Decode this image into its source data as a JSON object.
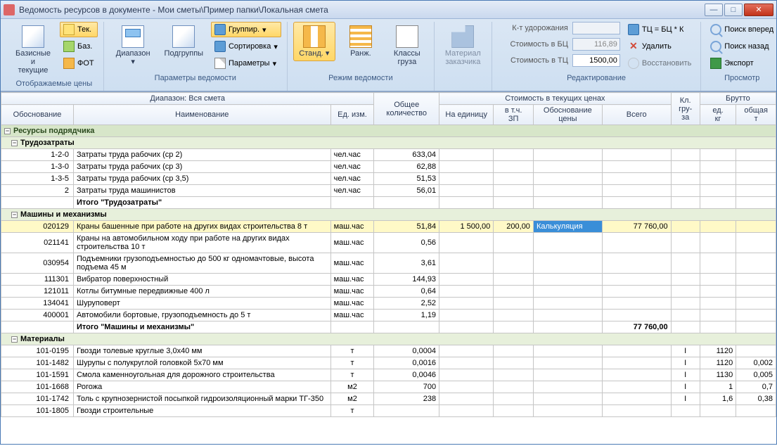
{
  "window": {
    "title": "Ведомость ресурсов в документе - Мои сметы\\Пример папки\\Локальная смета"
  },
  "ribbon": {
    "grp_prices": {
      "big": "Базисные\nи текущие",
      "tek": "Тек.",
      "baz": "Баз.",
      "fot": "ФОТ",
      "label": "Отображаемые цены"
    },
    "grp_params": {
      "range": "Диапазон",
      "subgroups": "Подгруппы",
      "group": "Группир.",
      "sort": "Сортировка",
      "params": "Параметры",
      "label": "Параметры ведомости"
    },
    "grp_mode": {
      "std": "Станд.",
      "rank": "Ранж.",
      "classes": "Классы\nгруза",
      "label": "Режим ведомости"
    },
    "grp_cust": {
      "mat": "Материал\nзаказчика"
    },
    "grp_edit": {
      "kud": "К-т удорожания",
      "sbc": "Стоимость в БЦ",
      "stc": "Стоимость в ТЦ",
      "sbc_val": "116,89",
      "stc_val": "1500,00",
      "formula": "ТЦ = БЦ * К",
      "del": "Удалить",
      "restore": "Восстановить",
      "label": "Редактирование"
    },
    "grp_view": {
      "fwd": "Поиск вперед",
      "back": "Поиск назад",
      "export": "Экспорт",
      "label": "Просмотр"
    }
  },
  "headers": {
    "range_full": "Диапазон: Вся смета",
    "obos": "Обоснование",
    "name": "Наименование",
    "ed": "Ед. изм.",
    "qty": "Общее\nколичество",
    "cost_group": "Стоимость в текущих ценах",
    "unit": "На единицу",
    "zp": "в т.ч.\nЗП",
    "obosn_price": "Обоснование\nцены",
    "total": "Всего",
    "kl": "Кл.\nгру-\nза",
    "brutto": "Брутто",
    "edkg": "ед.\nкг",
    "obsh": "общая\nт"
  },
  "groups": {
    "g1": "Ресурсы подрядчика",
    "g2": "Трудозатраты",
    "g2_total": "Итого \"Трудозатраты\"",
    "g3": "Машины и механизмы",
    "g3_total": "Итого \"Машины и механизмы\"",
    "g3_total_val": "77 760,00",
    "g4": "Материалы"
  },
  "rows": {
    "r1": {
      "code": "1-2-0",
      "name": "Затраты труда рабочих (ср 2)",
      "ed": "чел.час",
      "qty": "633,04"
    },
    "r2": {
      "code": "1-3-0",
      "name": "Затраты труда рабочих (ср 3)",
      "ed": "чел.час",
      "qty": "62,88"
    },
    "r3": {
      "code": "1-3-5",
      "name": "Затраты труда рабочих (ср 3,5)",
      "ed": "чел.час",
      "qty": "51,53"
    },
    "r4": {
      "code": "2",
      "name": "Затраты труда машинистов",
      "ed": "чел.час",
      "qty": "56,01"
    },
    "m1": {
      "code": "020129",
      "name": "Краны башенные при работе на других видах строительства 8 т",
      "ed": "маш.час",
      "qty": "51,84",
      "unit": "1 500,00",
      "zp": "200,00",
      "obp": "Калькуляция",
      "total": "77 760,00"
    },
    "m2": {
      "code": "021141",
      "name": "Краны на автомобильном ходу при работе на других видах строительства 10 т",
      "ed": "маш.час",
      "qty": "0,56"
    },
    "m3": {
      "code": "030954",
      "name": "Подъемники грузоподъемностью до 500 кг одномачтовые, высота подъема 45 м",
      "ed": "маш.час",
      "qty": "3,61"
    },
    "m4": {
      "code": "111301",
      "name": "Вибратор поверхностный",
      "ed": "маш.час",
      "qty": "144,93"
    },
    "m5": {
      "code": "121011",
      "name": "Котлы битумные передвижные 400 л",
      "ed": "маш.час",
      "qty": "0,64"
    },
    "m6": {
      "code": "134041",
      "name": "Шуруповерт",
      "ed": "маш.час",
      "qty": "2,52"
    },
    "m7": {
      "code": "400001",
      "name": "Автомобили бортовые, грузоподъемность до 5 т",
      "ed": "маш.час",
      "qty": "1,19"
    },
    "mat1": {
      "code": "101-0195",
      "name": "Гвозди толевые круглые 3,0х40 мм",
      "ed": "т",
      "qty": "0,0004",
      "kl": "I",
      "kg": "1120"
    },
    "mat2": {
      "code": "101-1482",
      "name": "Шурупы с полукруглой головкой 5х70 мм",
      "ed": "т",
      "qty": "0,0016",
      "kl": "I",
      "kg": "1120",
      "t": "0,002"
    },
    "mat3": {
      "code": "101-1591",
      "name": "Смола каменноугольная для дорожного строительства",
      "ed": "т",
      "qty": "0,0046",
      "kl": "I",
      "kg": "1130",
      "t": "0,005"
    },
    "mat4": {
      "code": "101-1668",
      "name": "Рогожа",
      "ed": "м2",
      "qty": "700",
      "kl": "I",
      "kg": "1",
      "t": "0,7"
    },
    "mat5": {
      "code": "101-1742",
      "name": "Толь с крупнозернистой посыпкой гидроизоляционный марки ТГ-350",
      "ed": "м2",
      "qty": "238",
      "kl": "I",
      "kg": "1,6",
      "t": "0,38"
    },
    "mat6": {
      "code": "101-1805",
      "name": "Гвозди строительные",
      "ed": "т",
      "qty": ""
    }
  }
}
